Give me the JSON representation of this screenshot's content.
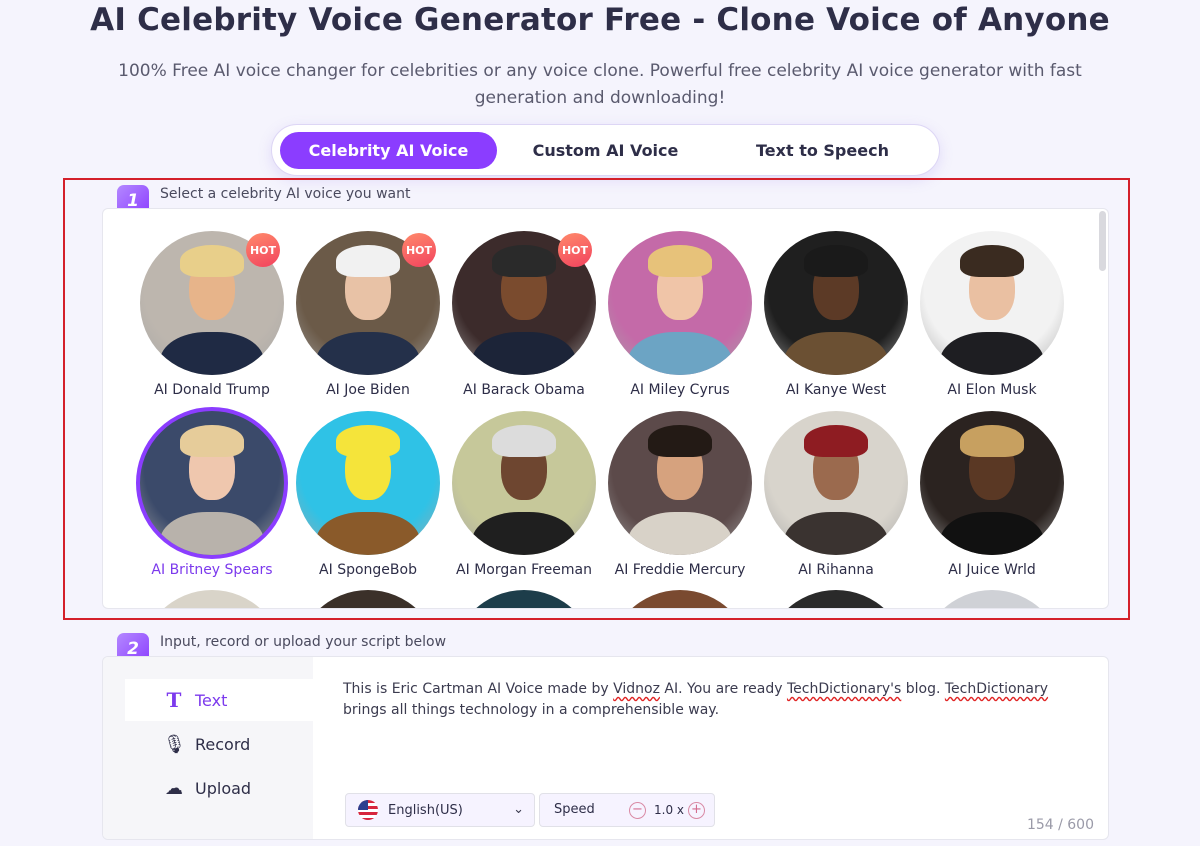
{
  "page": {
    "title": "AI Celebrity Voice Generator Free - Clone Voice of Anyone",
    "subtitle": "100% Free AI voice changer for celebrities or any voice clone. Powerful free celebrity AI voice generator with fast generation and downloading!"
  },
  "tabs": [
    {
      "label": "Celebrity AI Voice",
      "active": true
    },
    {
      "label": "Custom AI Voice",
      "active": false
    },
    {
      "label": "Text to Speech",
      "active": false
    }
  ],
  "step1": {
    "number": "1",
    "label": "Select a celebrity AI voice you want"
  },
  "voices": [
    {
      "name": "AI Donald Trump",
      "hot": "HOT",
      "bg": "#bdb6ae",
      "skin": "#e7b48a",
      "hair": "#e8cf8a",
      "body": "#1f2a44"
    },
    {
      "name": "AI Joe Biden",
      "hot": "HOT",
      "bg": "#6b5a48",
      "skin": "#e8c2a6",
      "hair": "#f1f1f1",
      "body": "#24304a"
    },
    {
      "name": "AI Barack Obama",
      "hot": "HOT",
      "bg": "#3c2b2b",
      "skin": "#7a4b2e",
      "hair": "#2a2a2a",
      "body": "#1c2438"
    },
    {
      "name": "AI Miley Cyrus",
      "bg": "#c46aa8",
      "skin": "#f0c5a8",
      "hair": "#e7c27a",
      "body": "#6ca4c4"
    },
    {
      "name": "AI Kanye West",
      "bg": "#1f1f1f",
      "skin": "#5c3a26",
      "hair": "#1a1a1a",
      "body": "#6b5033"
    },
    {
      "name": "AI Elon Musk",
      "bg": "#f2f2f2",
      "skin": "#eac0a2",
      "hair": "#3a2b20",
      "body": "#1e1e22"
    },
    {
      "name": "AI Britney Spears",
      "bg": "#3b4a6a",
      "skin": "#efc7ae",
      "hair": "#e6cc9a",
      "body": "#b8b2ab",
      "selected": true
    },
    {
      "name": "AI SpongeBob",
      "bg": "#2fc2e6",
      "skin": "#f5e43a",
      "hair": "#f5e43a",
      "body": "#8a5a2a"
    },
    {
      "name": "AI Morgan Freeman",
      "bg": "#c6c89a",
      "skin": "#6e4630",
      "hair": "#dcdcdc",
      "body": "#1f1f1f"
    },
    {
      "name": "AI Freddie Mercury",
      "bg": "#5c4a4a",
      "skin": "#d6a27e",
      "hair": "#231a15",
      "body": "#d8d2c8"
    },
    {
      "name": "AI Rihanna",
      "bg": "#d8d4cc",
      "skin": "#9b6a4e",
      "hair": "#8e1c22",
      "body": "#3a3330"
    },
    {
      "name": "AI Juice Wrld",
      "bg": "#2b2320",
      "skin": "#5a3824",
      "hair": "#c7a060",
      "body": "#111111"
    }
  ],
  "partial_row_colors": [
    "#d9d4c9",
    "#3b3029",
    "#1d3d4a",
    "#7a4a30",
    "#2a2a2a",
    "#cfd1d6"
  ],
  "step2": {
    "number": "2",
    "label": "Input, record or upload your script below"
  },
  "input_modes": [
    {
      "label": "Text",
      "icon": "T",
      "active": true
    },
    {
      "label": "Record",
      "icon": "🎙",
      "active": false
    },
    {
      "label": "Upload",
      "icon": "☁",
      "active": false
    }
  ],
  "script": {
    "part1": "This is Eric Cartman AI Voice made by ",
    "squiggle1": "Vidnoz",
    "part2": " AI. You are ready ",
    "squiggle2": "TechDictionary's",
    "part3": " blog. ",
    "squiggle3": "TechDictionary",
    "part4": " brings all things technology in a comprehensible way."
  },
  "language": {
    "value": "English(US)"
  },
  "speed": {
    "label": "Speed",
    "value": "1.0 x",
    "minus": "−",
    "plus": "+"
  },
  "counter": "154 / 600",
  "colors": {
    "accent": "#8b3dff",
    "highlight_border": "#d4202a",
    "hot_badge": "#f2425e"
  }
}
